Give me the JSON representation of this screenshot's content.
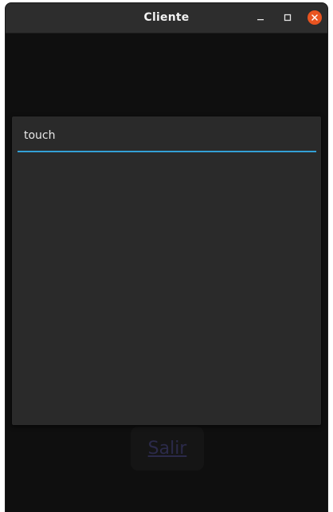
{
  "window": {
    "title": "Cliente",
    "controls": {
      "minimize_icon": "minimize-icon",
      "maximize_icon": "maximize-icon",
      "close_icon": "close-icon"
    },
    "colors": {
      "titlebar": "#2d2d2d",
      "close_button": "#e95420",
      "background": "#0f0f0f"
    }
  },
  "main": {
    "exit_button_label": "Salir"
  },
  "dialog": {
    "input_value": "touch",
    "colors": {
      "background": "#2a2a2a",
      "focus_underline": "#33a0d6"
    }
  }
}
